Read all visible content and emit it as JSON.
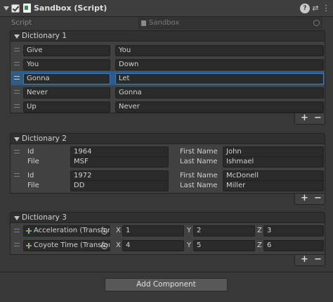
{
  "component": {
    "title": "Sandbox (Script)",
    "header_icons": [
      "help-icon",
      "presets-icon",
      "context-menu-icon"
    ]
  },
  "script_field": {
    "label": "Script",
    "value": "Sandbox"
  },
  "dictionary1": {
    "label": "Dictionary 1",
    "rows": [
      {
        "key": "Give",
        "value": "You"
      },
      {
        "key": "You",
        "value": "Down"
      },
      {
        "key": "Gonna",
        "value": "Let"
      },
      {
        "key": "Never",
        "value": "Gonna"
      },
      {
        "key": "Up",
        "value": "Never"
      }
    ]
  },
  "dictionary2": {
    "label": "Dictionary 2",
    "labels": {
      "id": "Id",
      "file": "File",
      "first_name": "First Name",
      "last_name": "Last Name"
    },
    "rows": [
      {
        "id": "1964",
        "file": "MSF",
        "first_name": "John",
        "last_name": "Ishmael"
      },
      {
        "id": "1972",
        "file": "DD",
        "first_name": "McDonell",
        "last_name": "Miller"
      }
    ]
  },
  "dictionary3": {
    "label": "Dictionary 3",
    "axis_labels": {
      "x": "X",
      "y": "Y",
      "z": "Z"
    },
    "rows": [
      {
        "object": "Acceleration (Transfor",
        "x": "1",
        "y": "2",
        "z": "3"
      },
      {
        "object": "Coyote Time (Transfor",
        "x": "4",
        "y": "5",
        "z": "6"
      }
    ]
  },
  "list_controls": {
    "add": "+",
    "remove": "−"
  },
  "add_component": "Add Component",
  "colors": {
    "background": "#383838",
    "selected_row": "#2c5d87",
    "field": "#2a2a2a"
  }
}
